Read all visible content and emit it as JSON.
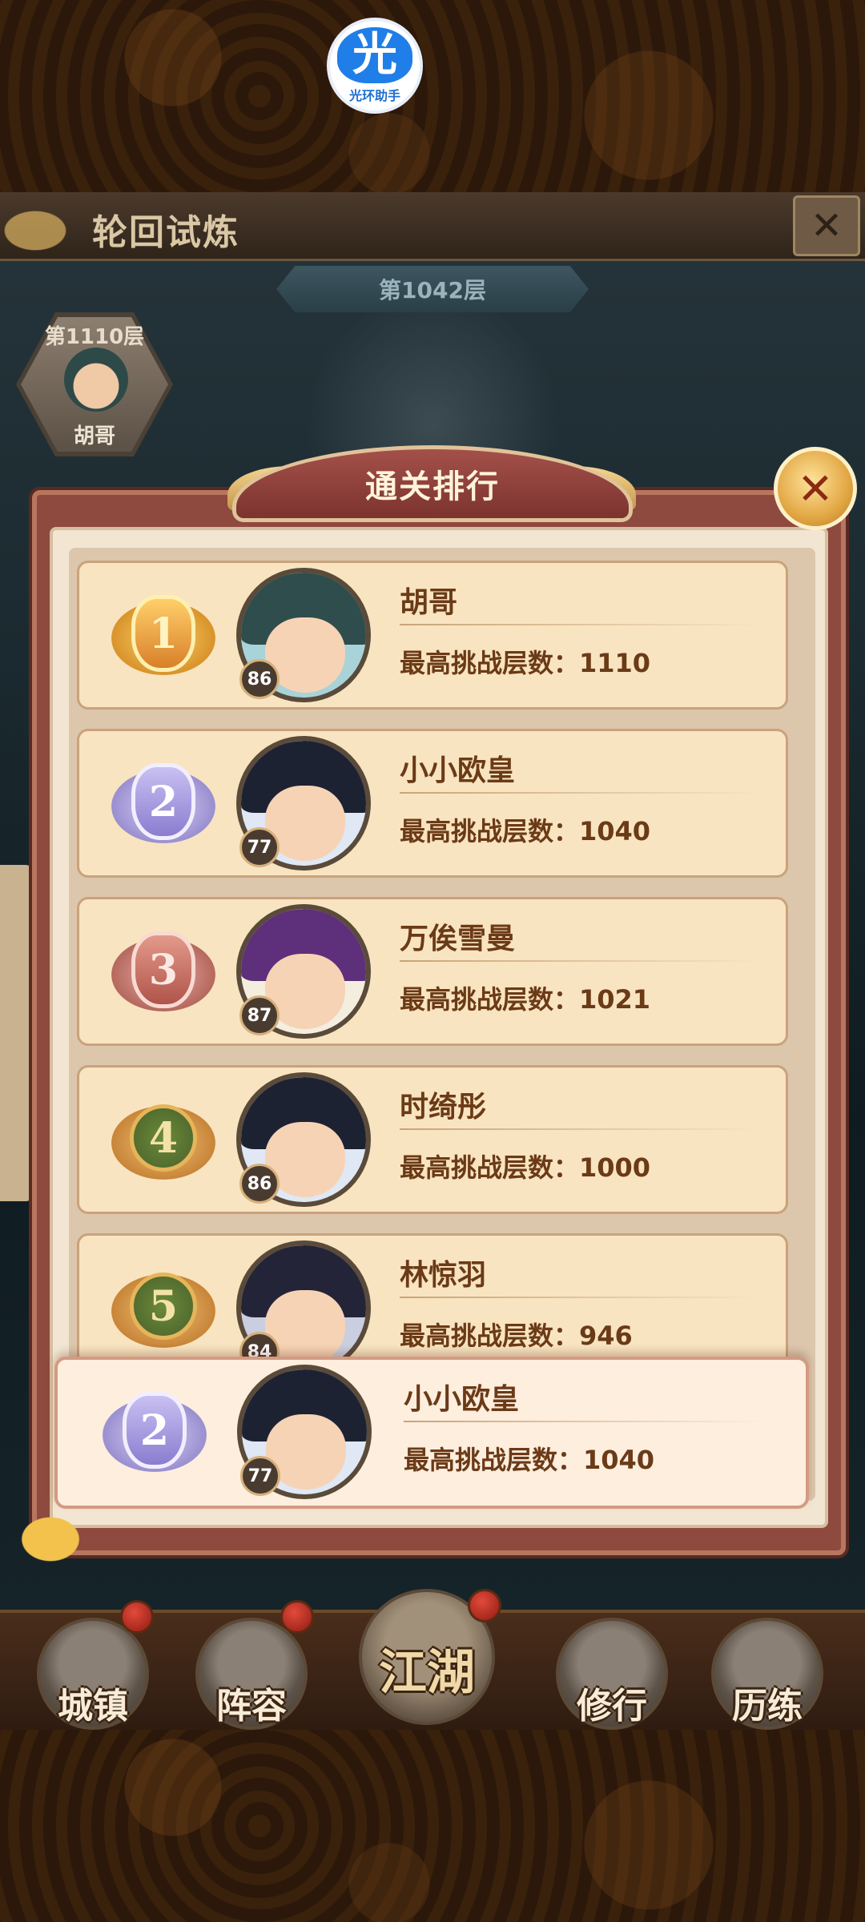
{
  "overlay": {
    "logo_glyph": "光",
    "logo_text": "光环助手"
  },
  "header": {
    "title": "轮回试炼",
    "close_icon": "✕"
  },
  "floor_banner": "第1042层",
  "player_marker": {
    "floor": "第1110层",
    "name": "胡哥"
  },
  "dialog": {
    "title": "通关排行",
    "close_icon": "✕",
    "ranks": [
      {
        "rank": "1",
        "name": "胡哥",
        "level": "86",
        "score_label": "最高挑战层数：1110",
        "badge": "gold",
        "hair": "#2f4d4d"
      },
      {
        "rank": "2",
        "name": "小小欧皇",
        "level": "77",
        "score_label": "最高挑战层数：1040",
        "badge": "silver",
        "hair": "#1d2233"
      },
      {
        "rank": "3",
        "name": "万俟雪曼",
        "level": "87",
        "score_label": "最高挑战层数：1021",
        "badge": "bronze",
        "hair": "#5e2f7a"
      },
      {
        "rank": "4",
        "name": "时绮彤",
        "level": "86",
        "score_label": "最高挑战层数：1000",
        "badge": "green",
        "hair": "#1d2233"
      },
      {
        "rank": "5",
        "name": "林惊羽",
        "level": "84",
        "score_label": "最高挑战层数：946",
        "badge": "green",
        "hair": "#232437"
      }
    ],
    "my_rank": {
      "rank": "2",
      "name": "小小欧皇",
      "level": "77",
      "score_label": "最高挑战层数：1040",
      "badge": "silver",
      "hair": "#1d2233"
    }
  },
  "bottom_nav": [
    {
      "label": "城镇"
    },
    {
      "label": "阵容"
    },
    {
      "label": "江湖"
    },
    {
      "label": "修行"
    },
    {
      "label": "历练"
    }
  ],
  "colors": {
    "accent_text": "#6b3a17",
    "row_bg": "#f8e4c0",
    "dialog_frame": "#8e4a3e"
  }
}
